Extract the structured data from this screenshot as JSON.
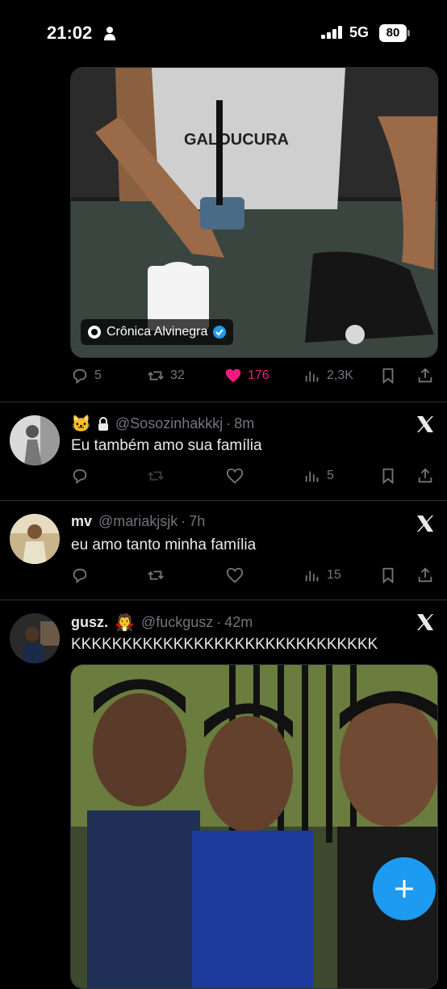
{
  "status_bar": {
    "time": "21:02",
    "network": "5G",
    "battery": "80"
  },
  "main_tweet": {
    "source_label": "Crônica Alvinegra",
    "metrics": {
      "replies": "5",
      "reposts": "32",
      "likes": "176",
      "views": "2,3K"
    }
  },
  "replies": [
    {
      "emoji": "🐱",
      "locked": true,
      "handle": "@Sosozinhakkkj",
      "time": "8m",
      "text": "Eu também amo sua família",
      "views": "5"
    },
    {
      "name": "mv",
      "handle": "@mariakjsjk",
      "time": "7h",
      "text": "eu amo tanto minha família",
      "views": "15"
    },
    {
      "name": "gusz.",
      "emoji": "🧛",
      "handle": "@fuckgusz",
      "time": "42m",
      "text": "KKKKKKKKKKKKKKKKKKKKKKKKKKKKKK"
    }
  ],
  "colors": {
    "accent": "#1d9bf0",
    "like": "#f91880",
    "muted": "#71767b",
    "verified": "#1d9bf0"
  },
  "icons": [
    "reply-icon",
    "repost-icon",
    "like-icon",
    "views-icon",
    "bookmark-icon",
    "share-icon",
    "x-logo-icon",
    "lock-icon",
    "verified-icon",
    "compose-icon"
  ]
}
